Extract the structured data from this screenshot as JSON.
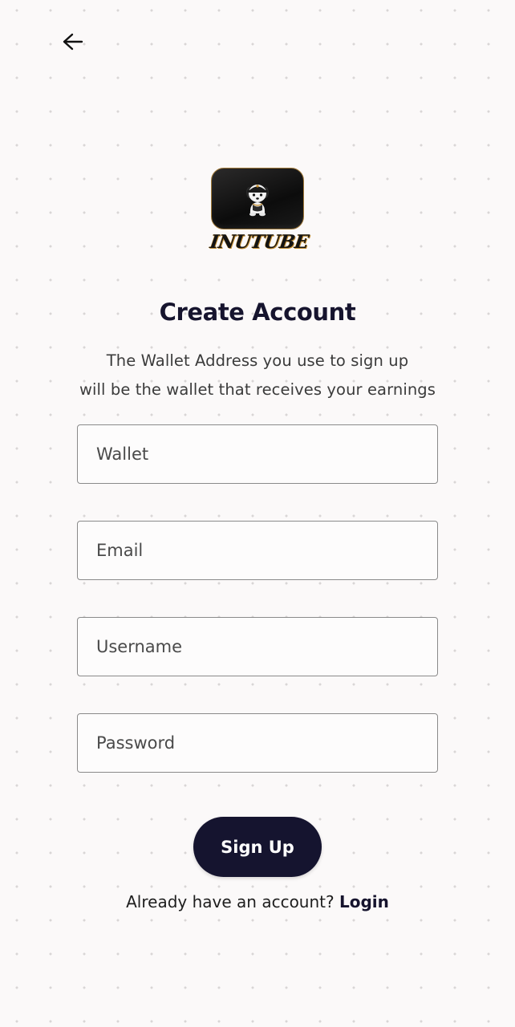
{
  "header": {
    "back_icon": "arrow-left-icon"
  },
  "logo": {
    "text": "INUTUBE",
    "icon": "dog-mascot-icon",
    "colors": {
      "box": "#111111",
      "border": "#a17a3a",
      "accent": "#c18a2c"
    }
  },
  "page": {
    "title": "Create Account",
    "subtitle_line1": "The Wallet Address you use to sign up",
    "subtitle_line2": "will be the wallet that receives your earnings"
  },
  "form": {
    "wallet": {
      "placeholder": "Wallet",
      "value": ""
    },
    "email": {
      "placeholder": "Email",
      "value": ""
    },
    "username": {
      "placeholder": "Username",
      "value": ""
    },
    "password": {
      "placeholder": "Password",
      "value": ""
    },
    "submit_label": "Sign Up"
  },
  "footer": {
    "prompt": "Already have an account?",
    "login_label": "Login"
  },
  "colors": {
    "primary": "#15142f",
    "background": "#fbf9f9",
    "field_border": "#8a8a8a"
  }
}
